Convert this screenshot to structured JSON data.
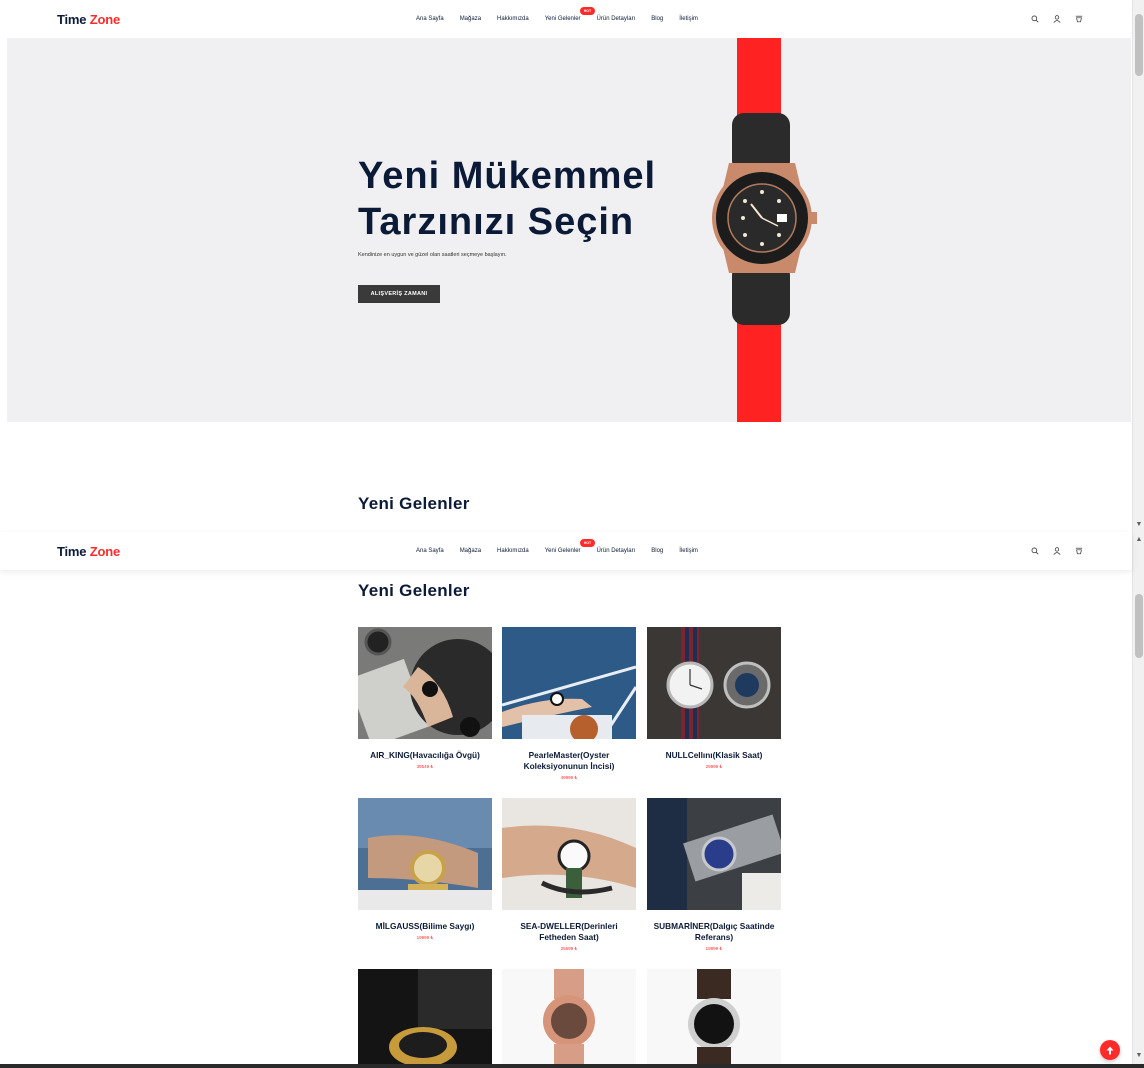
{
  "header": {
    "logo_time": "Time",
    "logo_zone": "Zone",
    "nav": [
      {
        "label": "Ana Sayfa"
      },
      {
        "label": "Mağaza"
      },
      {
        "label": "Hakkımızda"
      },
      {
        "label": "Yeni Gelenler",
        "badge": "HOT"
      },
      {
        "label": "Ürün Detayları"
      },
      {
        "label": "Blog"
      },
      {
        "label": "İletişim"
      }
    ],
    "icons": [
      "search-icon",
      "user-icon",
      "cart-icon"
    ]
  },
  "hero": {
    "title_line1": "Yeni Mükemmel",
    "title_line2": "Tarzınızı Seçin",
    "subtitle": "Kendinize en uygun ve güzel olan saatleri seçmeye başlayın.",
    "button": "ALIŞVERİŞ ZAMANI"
  },
  "section": {
    "title": "Yeni Gelenler"
  },
  "products": [
    {
      "name": "AIR_KING(Havacılığa Övgü)",
      "price": "39549 ₺"
    },
    {
      "name": "PearleMaster(Oyster Koleksiyonunun İncisi)",
      "price": "49999 ₺"
    },
    {
      "name": "NULLCellını(Klasik Saat)",
      "price": "29999 ₺"
    },
    {
      "name": "MİLGAUSS(Bilime Saygı)",
      "price": "19999 ₺"
    },
    {
      "name": "SEA-DWELLER(Derinleri Fetheden Saat)",
      "price": "25699 ₺"
    },
    {
      "name": "SUBMARİNER(Dalgıç Saatinde Referans)",
      "price": "19999 ₺"
    }
  ],
  "colors": {
    "accent": "#ff2b2b",
    "navy": "#0b1a36",
    "hero_bg": "#f0f0f2"
  },
  "fab_icon": "arrow-up-icon"
}
